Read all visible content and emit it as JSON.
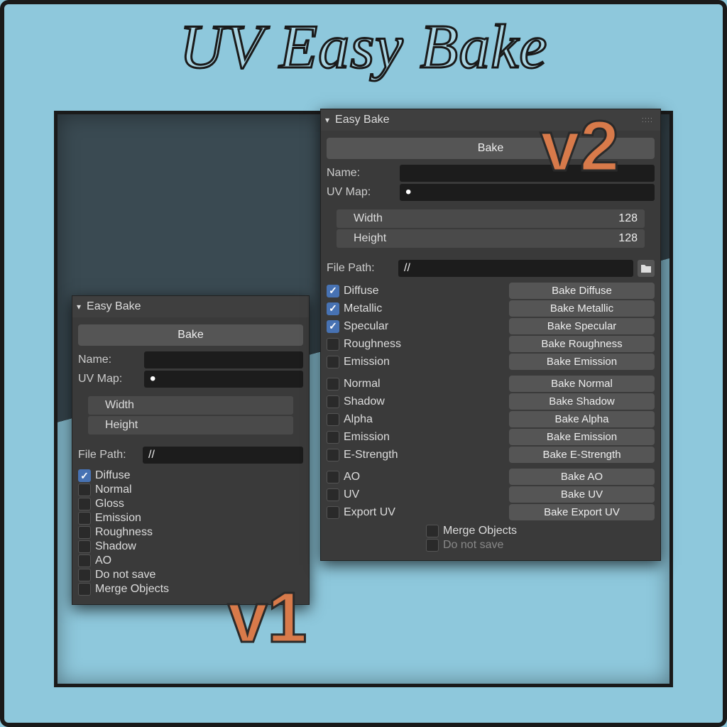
{
  "title": "UV Easy Bake",
  "version_labels": {
    "v1": "v1",
    "v2": "v2"
  },
  "common": {
    "panel_title": "Easy Bake",
    "bake_button": "Bake",
    "name_label": "Name:",
    "uvmap_label": "UV Map:",
    "width_label": "Width",
    "height_label": "Height",
    "filepath_label": "File Path:",
    "filepath_value": "//"
  },
  "v1": {
    "checks": [
      {
        "label": "Diffuse",
        "checked": true
      },
      {
        "label": "Normal",
        "checked": false
      },
      {
        "label": "Gloss",
        "checked": false
      },
      {
        "label": "Emission",
        "checked": false
      },
      {
        "label": "Roughness",
        "checked": false
      },
      {
        "label": "Shadow",
        "checked": false
      },
      {
        "label": "AO",
        "checked": false
      },
      {
        "label": "Do not save",
        "checked": false
      },
      {
        "label": "Merge Objects",
        "checked": false
      }
    ]
  },
  "v2": {
    "width": "128",
    "height": "128",
    "groups": [
      [
        {
          "label": "Diffuse",
          "checked": true,
          "btn": "Bake Diffuse"
        },
        {
          "label": "Metallic",
          "checked": true,
          "btn": "Bake Metallic"
        },
        {
          "label": "Specular",
          "checked": true,
          "btn": "Bake Specular"
        },
        {
          "label": "Roughness",
          "checked": false,
          "btn": "Bake Roughness"
        },
        {
          "label": "Emission",
          "checked": false,
          "btn": "Bake Emission"
        }
      ],
      [
        {
          "label": "Normal",
          "checked": false,
          "btn": "Bake Normal"
        },
        {
          "label": "Shadow",
          "checked": false,
          "btn": "Bake Shadow"
        },
        {
          "label": "Alpha",
          "checked": false,
          "btn": "Bake Alpha"
        },
        {
          "label": "Emission",
          "checked": false,
          "btn": "Bake Emission"
        },
        {
          "label": "E-Strength",
          "checked": false,
          "btn": "Bake E-Strength"
        }
      ],
      [
        {
          "label": "AO",
          "checked": false,
          "btn": "Bake AO"
        },
        {
          "label": "UV",
          "checked": false,
          "btn": "Bake UV"
        },
        {
          "label": "Export UV",
          "checked": false,
          "btn": "Bake Export UV"
        }
      ]
    ],
    "footer": [
      {
        "label": "Merge Objects",
        "checked": false,
        "dim": false
      },
      {
        "label": "Do not save",
        "checked": false,
        "dim": true
      }
    ]
  }
}
